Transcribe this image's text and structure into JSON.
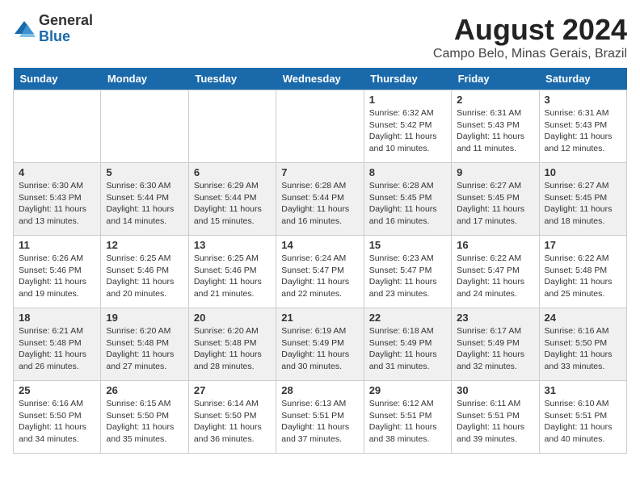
{
  "logo": {
    "general": "General",
    "blue": "Blue"
  },
  "title": "August 2024",
  "location": "Campo Belo, Minas Gerais, Brazil",
  "headers": [
    "Sunday",
    "Monday",
    "Tuesday",
    "Wednesday",
    "Thursday",
    "Friday",
    "Saturday"
  ],
  "weeks": [
    [
      {
        "day": "",
        "info": ""
      },
      {
        "day": "",
        "info": ""
      },
      {
        "day": "",
        "info": ""
      },
      {
        "day": "",
        "info": ""
      },
      {
        "day": "1",
        "info": "Sunrise: 6:32 AM\nSunset: 5:42 PM\nDaylight: 11 hours\nand 10 minutes."
      },
      {
        "day": "2",
        "info": "Sunrise: 6:31 AM\nSunset: 5:43 PM\nDaylight: 11 hours\nand 11 minutes."
      },
      {
        "day": "3",
        "info": "Sunrise: 6:31 AM\nSunset: 5:43 PM\nDaylight: 11 hours\nand 12 minutes."
      }
    ],
    [
      {
        "day": "4",
        "info": "Sunrise: 6:30 AM\nSunset: 5:43 PM\nDaylight: 11 hours\nand 13 minutes."
      },
      {
        "day": "5",
        "info": "Sunrise: 6:30 AM\nSunset: 5:44 PM\nDaylight: 11 hours\nand 14 minutes."
      },
      {
        "day": "6",
        "info": "Sunrise: 6:29 AM\nSunset: 5:44 PM\nDaylight: 11 hours\nand 15 minutes."
      },
      {
        "day": "7",
        "info": "Sunrise: 6:28 AM\nSunset: 5:44 PM\nDaylight: 11 hours\nand 16 minutes."
      },
      {
        "day": "8",
        "info": "Sunrise: 6:28 AM\nSunset: 5:45 PM\nDaylight: 11 hours\nand 16 minutes."
      },
      {
        "day": "9",
        "info": "Sunrise: 6:27 AM\nSunset: 5:45 PM\nDaylight: 11 hours\nand 17 minutes."
      },
      {
        "day": "10",
        "info": "Sunrise: 6:27 AM\nSunset: 5:45 PM\nDaylight: 11 hours\nand 18 minutes."
      }
    ],
    [
      {
        "day": "11",
        "info": "Sunrise: 6:26 AM\nSunset: 5:46 PM\nDaylight: 11 hours\nand 19 minutes."
      },
      {
        "day": "12",
        "info": "Sunrise: 6:25 AM\nSunset: 5:46 PM\nDaylight: 11 hours\nand 20 minutes."
      },
      {
        "day": "13",
        "info": "Sunrise: 6:25 AM\nSunset: 5:46 PM\nDaylight: 11 hours\nand 21 minutes."
      },
      {
        "day": "14",
        "info": "Sunrise: 6:24 AM\nSunset: 5:47 PM\nDaylight: 11 hours\nand 22 minutes."
      },
      {
        "day": "15",
        "info": "Sunrise: 6:23 AM\nSunset: 5:47 PM\nDaylight: 11 hours\nand 23 minutes."
      },
      {
        "day": "16",
        "info": "Sunrise: 6:22 AM\nSunset: 5:47 PM\nDaylight: 11 hours\nand 24 minutes."
      },
      {
        "day": "17",
        "info": "Sunrise: 6:22 AM\nSunset: 5:48 PM\nDaylight: 11 hours\nand 25 minutes."
      }
    ],
    [
      {
        "day": "18",
        "info": "Sunrise: 6:21 AM\nSunset: 5:48 PM\nDaylight: 11 hours\nand 26 minutes."
      },
      {
        "day": "19",
        "info": "Sunrise: 6:20 AM\nSunset: 5:48 PM\nDaylight: 11 hours\nand 27 minutes."
      },
      {
        "day": "20",
        "info": "Sunrise: 6:20 AM\nSunset: 5:48 PM\nDaylight: 11 hours\nand 28 minutes."
      },
      {
        "day": "21",
        "info": "Sunrise: 6:19 AM\nSunset: 5:49 PM\nDaylight: 11 hours\nand 30 minutes."
      },
      {
        "day": "22",
        "info": "Sunrise: 6:18 AM\nSunset: 5:49 PM\nDaylight: 11 hours\nand 31 minutes."
      },
      {
        "day": "23",
        "info": "Sunrise: 6:17 AM\nSunset: 5:49 PM\nDaylight: 11 hours\nand 32 minutes."
      },
      {
        "day": "24",
        "info": "Sunrise: 6:16 AM\nSunset: 5:50 PM\nDaylight: 11 hours\nand 33 minutes."
      }
    ],
    [
      {
        "day": "25",
        "info": "Sunrise: 6:16 AM\nSunset: 5:50 PM\nDaylight: 11 hours\nand 34 minutes."
      },
      {
        "day": "26",
        "info": "Sunrise: 6:15 AM\nSunset: 5:50 PM\nDaylight: 11 hours\nand 35 minutes."
      },
      {
        "day": "27",
        "info": "Sunrise: 6:14 AM\nSunset: 5:50 PM\nDaylight: 11 hours\nand 36 minutes."
      },
      {
        "day": "28",
        "info": "Sunrise: 6:13 AM\nSunset: 5:51 PM\nDaylight: 11 hours\nand 37 minutes."
      },
      {
        "day": "29",
        "info": "Sunrise: 6:12 AM\nSunset: 5:51 PM\nDaylight: 11 hours\nand 38 minutes."
      },
      {
        "day": "30",
        "info": "Sunrise: 6:11 AM\nSunset: 5:51 PM\nDaylight: 11 hours\nand 39 minutes."
      },
      {
        "day": "31",
        "info": "Sunrise: 6:10 AM\nSunset: 5:51 PM\nDaylight: 11 hours\nand 40 minutes."
      }
    ]
  ]
}
